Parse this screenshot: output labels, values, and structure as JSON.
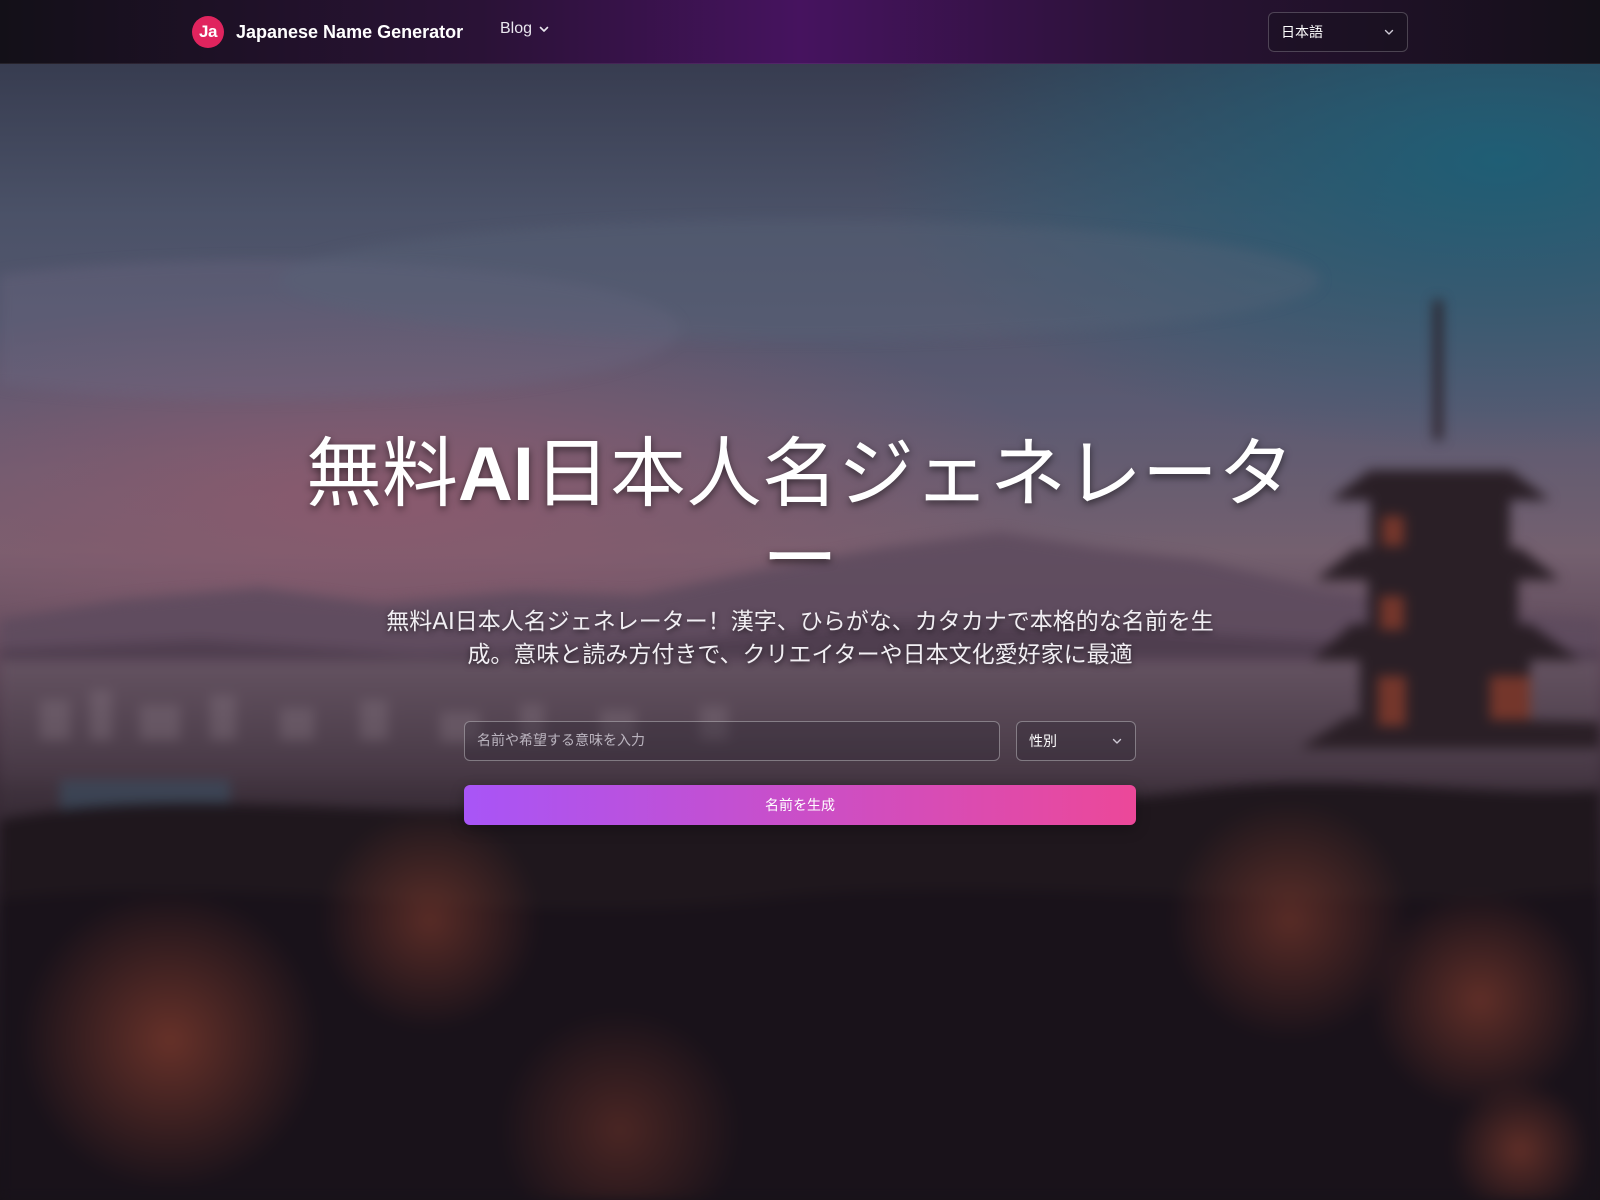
{
  "header": {
    "logo_text": "Ja",
    "brand": "Japanese Name Generator",
    "nav_blog": "Blog",
    "language": "日本語"
  },
  "hero": {
    "title_prefix": "無料",
    "title_ai": "AI",
    "title_suffix": "日本人名ジェネレーター",
    "subtitle": "無料AI日本人名ジェネレーター！漢字、ひらがな、カタカナで本格的な名前を生成。意味と読み方付きで、クリエイターや日本文化愛好家に最適"
  },
  "form": {
    "name_placeholder": "名前や希望する意味を入力",
    "name_value": "",
    "gender_label": "性別",
    "generate_button": "名前を生成"
  },
  "icons": {
    "logo": "ja-logo-icon",
    "dropdown": "chevron-down-icon",
    "background": "kyoto-pagoda-sunset-photo"
  },
  "colors": {
    "logo_bg": "#e0245e",
    "button_gradient_start": "#a855f7",
    "button_gradient_end": "#ec4899",
    "nav_accent": "#46135f"
  }
}
